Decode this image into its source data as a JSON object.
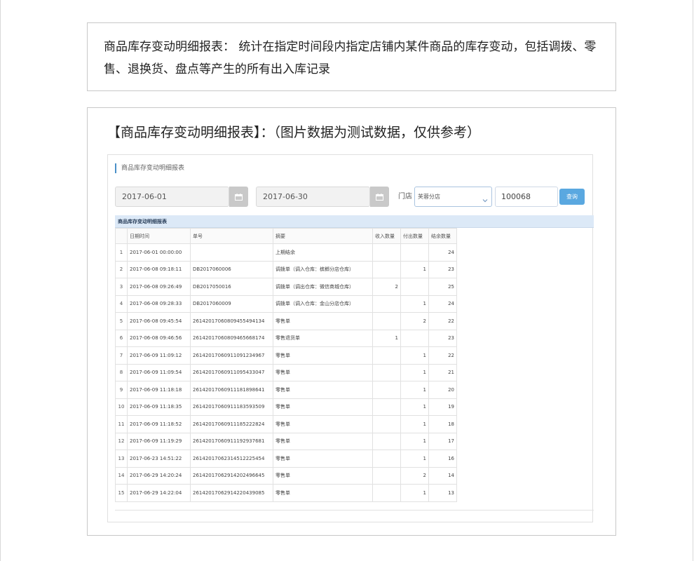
{
  "intro": {
    "text": "商品库存变动明细报表： 统计在指定时间段内指定店铺内某件商品的库存变动，包括调拨、零售、退换货、盘点等产生的所有出入库记录"
  },
  "report": {
    "heading": "【商品库存变动明细报表】：（图片数据为测试数据，仅供参考）",
    "panel_title": "商品库存变动明细报表"
  },
  "filters": {
    "start_date": "2017-06-01",
    "end_date": "2017-06-30",
    "store_label": "门店",
    "store_value": "芙蓉分店",
    "product_code": "100068",
    "query_label": "查询"
  },
  "grid": {
    "caption": "商品库存变动明细报表",
    "columns": [
      "",
      "日期时间",
      "单号",
      "摘要",
      "收入数量",
      "付出数量",
      "结余数量"
    ],
    "rows": [
      [
        "1",
        "2017-06-01 00:00:00",
        "",
        "上期结余",
        "",
        "",
        "24"
      ],
      [
        "2",
        "2017-06-08 09:18:11",
        "DB2017060006",
        "调拨单（调入仓库：槟榔分店仓库）",
        "",
        "1",
        "23"
      ],
      [
        "3",
        "2017-06-08 09:26:49",
        "DB2017050016",
        "调拨单（调出仓库：微信商城仓库）",
        "2",
        "",
        "25"
      ],
      [
        "4",
        "2017-06-08 09:28:33",
        "DB2017060009",
        "调拨单（调入仓库：金山分店仓库）",
        "",
        "1",
        "24"
      ],
      [
        "5",
        "2017-06-08 09:45:54",
        "2614201706080945549413​4",
        "零售单",
        "",
        "2",
        "22"
      ],
      [
        "6",
        "2017-06-08 09:46:56",
        "26142017060809465668174",
        "零售退货单",
        "1",
        "",
        "23"
      ],
      [
        "7",
        "2017-06-09 11:09:12",
        "26142017060911091234967",
        "零售单",
        "",
        "1",
        "22"
      ],
      [
        "8",
        "2017-06-09 11:09:54",
        "26142017060911095433047",
        "零售单",
        "",
        "1",
        "21"
      ],
      [
        "9",
        "2017-06-09 11:18:18",
        "26142017060911181898641",
        "零售单",
        "",
        "1",
        "20"
      ],
      [
        "10",
        "2017-06-09 11:18:35",
        "26142017060911183593509",
        "零售单",
        "",
        "1",
        "19"
      ],
      [
        "11",
        "2017-06-09 11:18:52",
        "26142017060911185222824",
        "零售单",
        "",
        "1",
        "18"
      ],
      [
        "12",
        "2017-06-09 11:19:29",
        "26142017060911192937681",
        "零售单",
        "",
        "1",
        "17"
      ],
      [
        "13",
        "2017-06-23 14:51:22",
        "26142017062314512225454",
        "零售单",
        "",
        "1",
        "16"
      ],
      [
        "14",
        "2017-06-29 14:20:24",
        "26142017062914202496645",
        "零售单",
        "",
        "2",
        "14"
      ],
      [
        "15",
        "2017-06-29 14:22:04",
        "26142017062914220439085",
        "零售单",
        "",
        "1",
        "13"
      ]
    ]
  },
  "icons": {
    "calendar": "calendar-icon",
    "dropdown": "chevron-down-icon"
  },
  "colors": {
    "accent": "#5aa8e0",
    "caption_bg": "#dce9f7",
    "calendar_btn": "#c9c9c9"
  }
}
